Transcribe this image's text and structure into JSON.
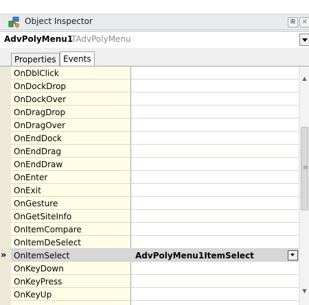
{
  "window": {
    "title": "Object Inspector",
    "pin_glyph": "⊞",
    "close_glyph": "✕"
  },
  "selector": {
    "component_name": "AdvPolyMenu1",
    "component_type": "TAdvPolyMenu"
  },
  "tabs": [
    {
      "label": "Properties",
      "active": false
    },
    {
      "label": "Events",
      "active": true
    }
  ],
  "events": [
    {
      "name": "OnDblClick",
      "value": ""
    },
    {
      "name": "OnDockDrop",
      "value": ""
    },
    {
      "name": "OnDockOver",
      "value": ""
    },
    {
      "name": "OnDragDrop",
      "value": ""
    },
    {
      "name": "OnDragOver",
      "value": ""
    },
    {
      "name": "OnEndDock",
      "value": ""
    },
    {
      "name": "OnEndDrag",
      "value": ""
    },
    {
      "name": "OnEndDraw",
      "value": ""
    },
    {
      "name": "OnEnter",
      "value": ""
    },
    {
      "name": "OnExit",
      "value": ""
    },
    {
      "name": "OnGesture",
      "value": ""
    },
    {
      "name": "OnGetSiteInfo",
      "value": ""
    },
    {
      "name": "OnItemCompare",
      "value": ""
    },
    {
      "name": "OnItemDeSelect",
      "value": ""
    },
    {
      "name": "OnItemSelect",
      "value": "AdvPolyMenu1ItemSelect"
    },
    {
      "name": "OnKeyDown",
      "value": ""
    },
    {
      "name": "OnKeyPress",
      "value": ""
    },
    {
      "name": "OnKeyUp",
      "value": ""
    }
  ],
  "selected_marker": "»",
  "icons": {
    "title_icon": "object-inspector-icon",
    "pin": "pin-icon",
    "close": "close-icon",
    "dropdown": "chevron-down-icon",
    "scroll_up": "scroll-up-arrow-icon",
    "scroll_down": "scroll-down-arrow-icon"
  },
  "colors": {
    "titlebar": "#e9eaec",
    "name_column": "#fffde6",
    "gutter": "#ece9d8",
    "selected_row": "#d6d6d6"
  }
}
